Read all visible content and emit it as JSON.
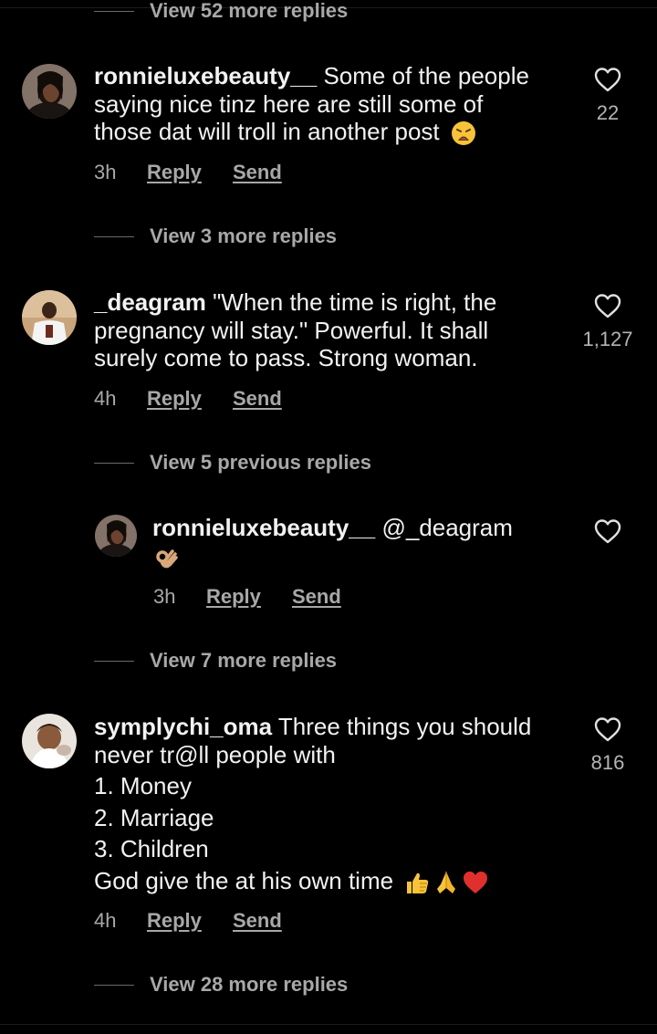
{
  "top_view_replies": "View 52 more replies",
  "comments": [
    {
      "username": "ronnieluxebeauty__",
      "lines": [
        "Some of the people",
        "saying nice tinz here are still some of",
        "those dat will troll in another post"
      ],
      "time": "3h",
      "reply_label": "Reply",
      "send_label": "Send",
      "likes": "22",
      "view_replies": "View 3 more replies"
    },
    {
      "username": "_deagram",
      "lines": [
        "\"When the time is right, the",
        "pregnancy will stay.\" Powerful. It shall",
        "surely come to pass. Strong woman."
      ],
      "time": "4h",
      "reply_label": "Reply",
      "send_label": "Send",
      "likes": "1,127",
      "view_replies": "View 5 previous replies",
      "reply": {
        "username": "ronnieluxebeauty__",
        "mention": "@_deagram",
        "time": "3h",
        "reply_label": "Reply",
        "send_label": "Send"
      },
      "view_more_replies": "View 7 more replies"
    },
    {
      "username": "symplychi_oma",
      "lines": [
        "Three things you should",
        "never tr@ll people with",
        "1. Money",
        "2. Marriage",
        "3. Children",
        "God give the at his own time"
      ],
      "time": "4h",
      "reply_label": "Reply",
      "send_label": "Send",
      "likes": "816",
      "view_replies": "View 28 more replies"
    }
  ],
  "icons": {
    "heart": "heart-outline-icon",
    "emoji_weary": "weary-face-emoji",
    "emoji_ok": "ok-hand-emoji",
    "emoji_thumbs": "thumbs-up-emoji",
    "emoji_pray": "folded-hands-emoji",
    "emoji_heart": "red-heart-emoji"
  },
  "colors": {
    "background": "#000000",
    "text": "#f2f2f2",
    "muted": "#a8a8a8",
    "heart_red": "#e0302d",
    "emoji_yellow": "#f7c33a"
  }
}
